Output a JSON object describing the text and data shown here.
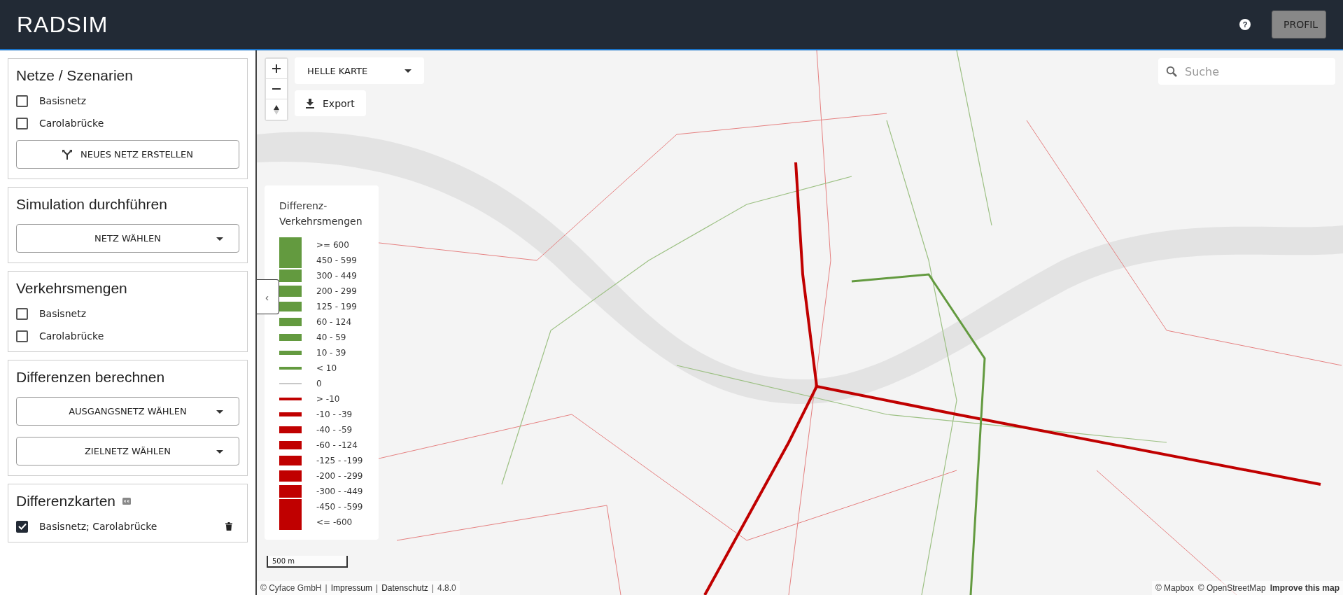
{
  "header": {
    "logo": "RADSIM",
    "help_button": "?",
    "profile_button": "PROFIL"
  },
  "sidebar": {
    "panels": [
      {
        "kind": "checklist",
        "title": "Netze / Szenarien",
        "items": [
          {
            "label": "Basisnetz",
            "checked": false
          },
          {
            "label": "Carolabrücke",
            "checked": false
          }
        ],
        "button": "NEUES NETZ ERSTELLEN"
      },
      {
        "kind": "selects",
        "title": "Simulation durchführen",
        "selects": [
          "NETZ WÄHLEN"
        ]
      },
      {
        "kind": "checklist",
        "title": "Verkehrsmengen",
        "items": [
          {
            "label": "Basisnetz",
            "checked": false
          },
          {
            "label": "Carolabrücke",
            "checked": false
          }
        ]
      },
      {
        "kind": "selects",
        "title": "Differenzen berechnen",
        "selects": [
          "AUSGANGSNETZ WÄHLEN",
          "ZIELNETZ WÄHLEN"
        ]
      },
      {
        "kind": "maps",
        "title": "Differenzkarten",
        "items": [
          {
            "label": "Basisnetz; Carolabrücke",
            "checked": true
          }
        ]
      }
    ]
  },
  "map": {
    "style_select": "HELLE KARTE",
    "export_button": "Export",
    "collapse_button": "‹",
    "search": {
      "placeholder": "Suche"
    },
    "legend": {
      "title": "Differenz-Verkehrsmengen",
      "items": [
        {
          "label": ">= 600",
          "color": "#639a3f"
        },
        {
          "label": "450 - 599",
          "color": "#639a3f"
        },
        {
          "label": "300 - 449",
          "color": "#639a3f"
        },
        {
          "label": "200 - 299",
          "color": "#639a3f"
        },
        {
          "label": "125 - 199",
          "color": "#639a3f"
        },
        {
          "label": "60 - 124",
          "color": "#639a3f"
        },
        {
          "label": "40 - 59",
          "color": "#639a3f"
        },
        {
          "label": "10 - 39",
          "color": "#639a3f"
        },
        {
          "label": "< 10",
          "color": "#639a3f"
        },
        {
          "label": "0",
          "color": "#c8c8c8"
        },
        {
          "label": "> -10",
          "color": "#c00000"
        },
        {
          "label": "-10 - -39",
          "color": "#c00000"
        },
        {
          "label": "-40 - -59",
          "color": "#c00000"
        },
        {
          "label": "-60 - -124",
          "color": "#c00000"
        },
        {
          "label": "-125 - -199",
          "color": "#c00000"
        },
        {
          "label": "-200 - -299",
          "color": "#c00000"
        },
        {
          "label": "-300 - -449",
          "color": "#c00000"
        },
        {
          "label": "-450 - -599",
          "color": "#c00000"
        },
        {
          "label": "<= -600",
          "color": "#c00000"
        }
      ]
    },
    "scale": "500 m",
    "attribution_left": [
      {
        "kind": "text",
        "text": "© Cyface GmbH"
      },
      {
        "kind": "separator",
        "text": "|"
      },
      {
        "kind": "link",
        "text": "Impressum"
      },
      {
        "kind": "separator",
        "text": "|"
      },
      {
        "kind": "link",
        "text": "Datenschutz"
      },
      {
        "kind": "separator",
        "text": "|"
      },
      {
        "kind": "text",
        "text": "4.8.0"
      }
    ],
    "attribution_right": [
      {
        "text": "© Mapbox",
        "bold": false
      },
      {
        "text": "© OpenStreetMap",
        "bold": false
      },
      {
        "text": "Improve this map",
        "bold": true
      }
    ]
  }
}
